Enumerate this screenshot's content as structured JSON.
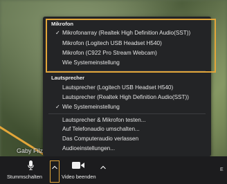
{
  "participant_name": "Gaby Filzm",
  "menu": {
    "microphone_header": "Mikrofon",
    "microphones": [
      {
        "label": "Mikrofonarray (Realtek High Definition Audio(SST))",
        "checked": true
      },
      {
        "label": "Mikrofon (Logitech USB Headset H540)",
        "checked": false
      },
      {
        "label": "Mikrofon (C922 Pro Stream Webcam)",
        "checked": false
      },
      {
        "label": "Wie Systemeinstellung",
        "checked": false
      }
    ],
    "speaker_header": "Lautsprecher",
    "speakers": [
      {
        "label": "Lautsprecher (Logitech USB Headset H540)",
        "checked": false
      },
      {
        "label": "Lautsprecher (Realtek High Definition Audio(SST))",
        "checked": false
      },
      {
        "label": "Wie Systemeinstellung",
        "checked": true
      }
    ],
    "actions": [
      "Lautsprecher & Mikrofon testen...",
      "Auf Telefonaudio umschalten...",
      "Das Computeraudio verlassen",
      "Audioeinstellungen..."
    ],
    "check_mark": "✓"
  },
  "toolbar": {
    "mute_label": "Stummschalten",
    "video_label": "Video beenden",
    "right_edge_label": "E"
  },
  "colors": {
    "highlight": "#e3a63a",
    "menu_bg": "#232426",
    "toolbar_bg": "#1c1c1e"
  }
}
